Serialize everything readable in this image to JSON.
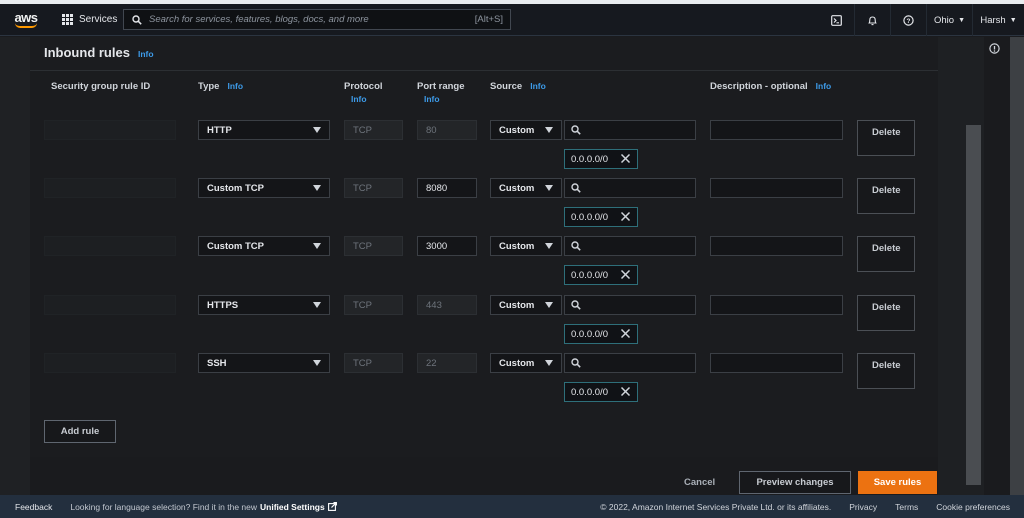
{
  "topbar": {
    "logo_text": "aws",
    "services_label": "Services",
    "search_placeholder": "Search for services, features, blogs, docs, and more",
    "search_shortcut": "[Alt+S]",
    "region": "Ohio",
    "user": "Harsh",
    "icons": [
      "cloudshell-icon",
      "bell-icon",
      "help-icon"
    ]
  },
  "panel": {
    "title": "Inbound rules",
    "title_info": "Info",
    "columns": [
      {
        "label": "Security group rule ID",
        "info": ""
      },
      {
        "label": "Type",
        "info": "Info"
      },
      {
        "label": "Protocol",
        "info": "Info"
      },
      {
        "label": "Port range",
        "info": "Info"
      },
      {
        "label": "Source",
        "info": "Info"
      },
      {
        "label": "Description - optional",
        "info": "Info"
      }
    ],
    "rules": [
      {
        "type": "HTTP",
        "protocol": "TCP",
        "port": "80",
        "port_editable": false,
        "source": "Custom",
        "cidr": "0.0.0.0/0",
        "description": "",
        "delete_label": "Delete"
      },
      {
        "type": "Custom TCP",
        "protocol": "TCP",
        "port": "8080",
        "port_editable": true,
        "source": "Custom",
        "cidr": "0.0.0.0/0",
        "description": "",
        "delete_label": "Delete"
      },
      {
        "type": "Custom TCP",
        "protocol": "TCP",
        "port": "3000",
        "port_editable": true,
        "source": "Custom",
        "cidr": "0.0.0.0/0",
        "description": "",
        "delete_label": "Delete"
      },
      {
        "type": "HTTPS",
        "protocol": "TCP",
        "port": "443",
        "port_editable": false,
        "source": "Custom",
        "cidr": "0.0.0.0/0",
        "description": "",
        "delete_label": "Delete"
      },
      {
        "type": "SSH",
        "protocol": "TCP",
        "port": "22",
        "port_editable": false,
        "source": "Custom",
        "cidr": "0.0.0.0/0",
        "description": "",
        "delete_label": "Delete"
      }
    ],
    "add_rule_label": "Add rule"
  },
  "actions": {
    "cancel": "Cancel",
    "preview": "Preview changes",
    "save": "Save rules"
  },
  "footer": {
    "feedback": "Feedback",
    "language_text": "Looking for language selection? Find it in the new",
    "unified_settings": "Unified Settings",
    "copyright": "© 2022, Amazon Internet Services Private Ltd. or its affiliates.",
    "privacy": "Privacy",
    "terms": "Terms",
    "cookies": "Cookie preferences"
  },
  "colors": {
    "accent_orange": "#ec7211",
    "info_blue": "#3d9be9",
    "header_bg": "#16191f",
    "footer_bg": "#232f3e",
    "token_border": "#2e6f7a"
  }
}
